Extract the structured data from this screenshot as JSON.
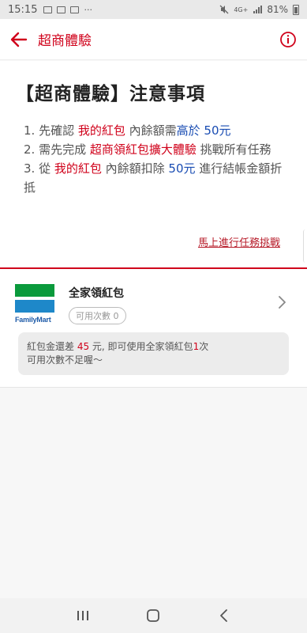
{
  "status_bar": {
    "time": "15:15",
    "more": "···",
    "network": "4G+",
    "battery": "81%"
  },
  "app_bar": {
    "title": "超商體驗",
    "accent_color": "#d0021b"
  },
  "notice": {
    "title": "【超商體驗】注意事項",
    "items": [
      {
        "prefix": "1. 先確認 ",
        "highlight1": "我的紅包",
        "middle": " 內餘額需",
        "highlight2": "高於 50元",
        "suffix": ""
      },
      {
        "prefix": "2. 需先完成 ",
        "highlight1": "超商領紅包擴大體驗",
        "middle": " 挑戰所有任務",
        "highlight2": "",
        "suffix": ""
      },
      {
        "prefix": "3. 從 ",
        "highlight1": "我的紅包",
        "middle": " 內餘額扣除 ",
        "highlight2": "50元",
        "suffix": " 進行結帳金額折抵"
      }
    ],
    "challenge_link": "馬上進行任務挑戰"
  },
  "card": {
    "logo_text": "FamilyMart",
    "title": "全家領紅包",
    "count_label": "可用次數 0",
    "hint_prefix": "紅包金還差 ",
    "hint_amount": "45",
    "hint_middle": " 元, 即可使用全家領紅包",
    "hint_count": "1",
    "hint_suffix": "次",
    "hint_line2": "可用次數不足喔～"
  },
  "nav": {
    "recents": "recents-icon",
    "home": "home-icon",
    "back": "back-icon"
  }
}
